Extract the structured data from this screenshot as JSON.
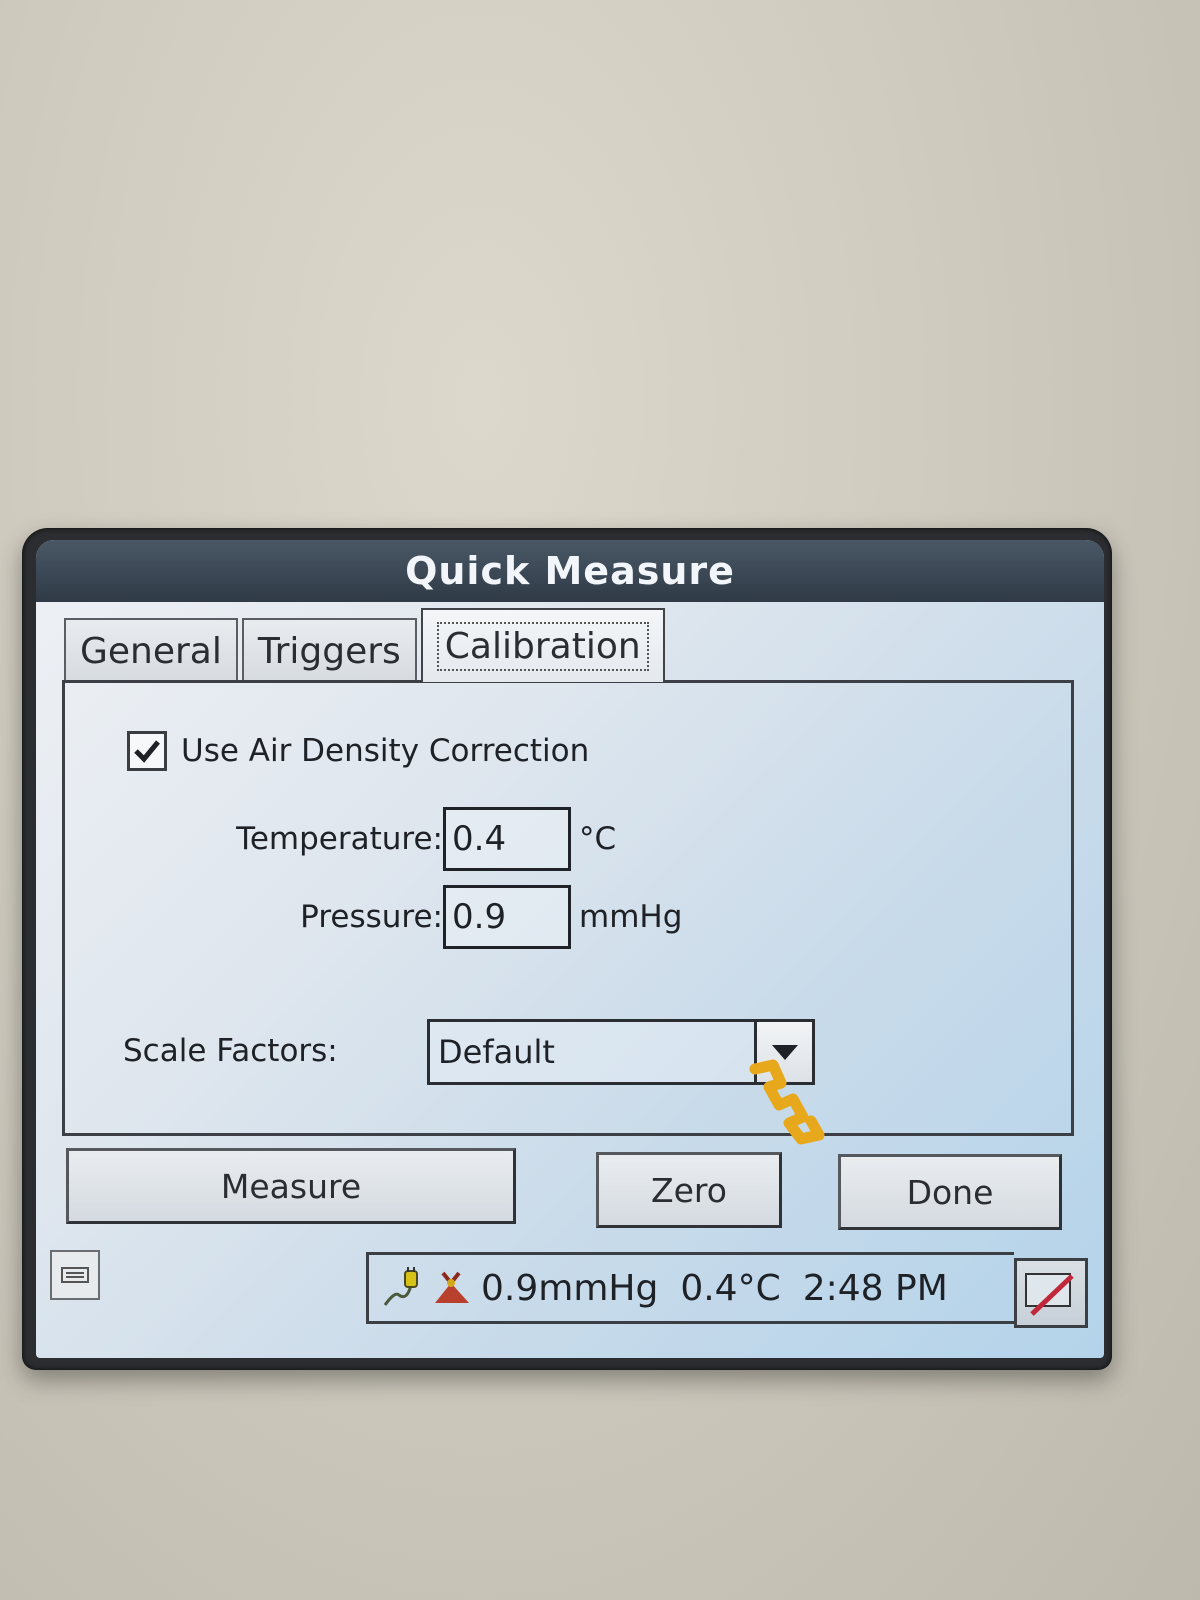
{
  "window": {
    "title": "Quick Measure"
  },
  "tabs": [
    {
      "label": "General",
      "active": false
    },
    {
      "label": "Triggers",
      "active": false
    },
    {
      "label": "Calibration",
      "active": true
    }
  ],
  "calibration": {
    "air_density": {
      "label": "Use Air Density Correction",
      "checked": true
    },
    "temperature": {
      "label": "Temperature:",
      "value": "0.4",
      "unit": "°C"
    },
    "pressure": {
      "label": "Pressure:",
      "value": "0.9",
      "unit": "mmHg"
    },
    "scale_factors": {
      "label": "Scale Factors:",
      "selected": "Default"
    }
  },
  "buttons": {
    "measure": "Measure",
    "zero": "Zero",
    "done": "Done"
  },
  "taskbar": {
    "pressure": "0.9mmHg",
    "temperature": "0.4°C",
    "time": "2:48 PM"
  },
  "colors": {
    "titlebar": "#2f3a46",
    "screen_accent": "#b4d3ea",
    "cursor": "#e8a81c",
    "pen": "#c0283a"
  }
}
